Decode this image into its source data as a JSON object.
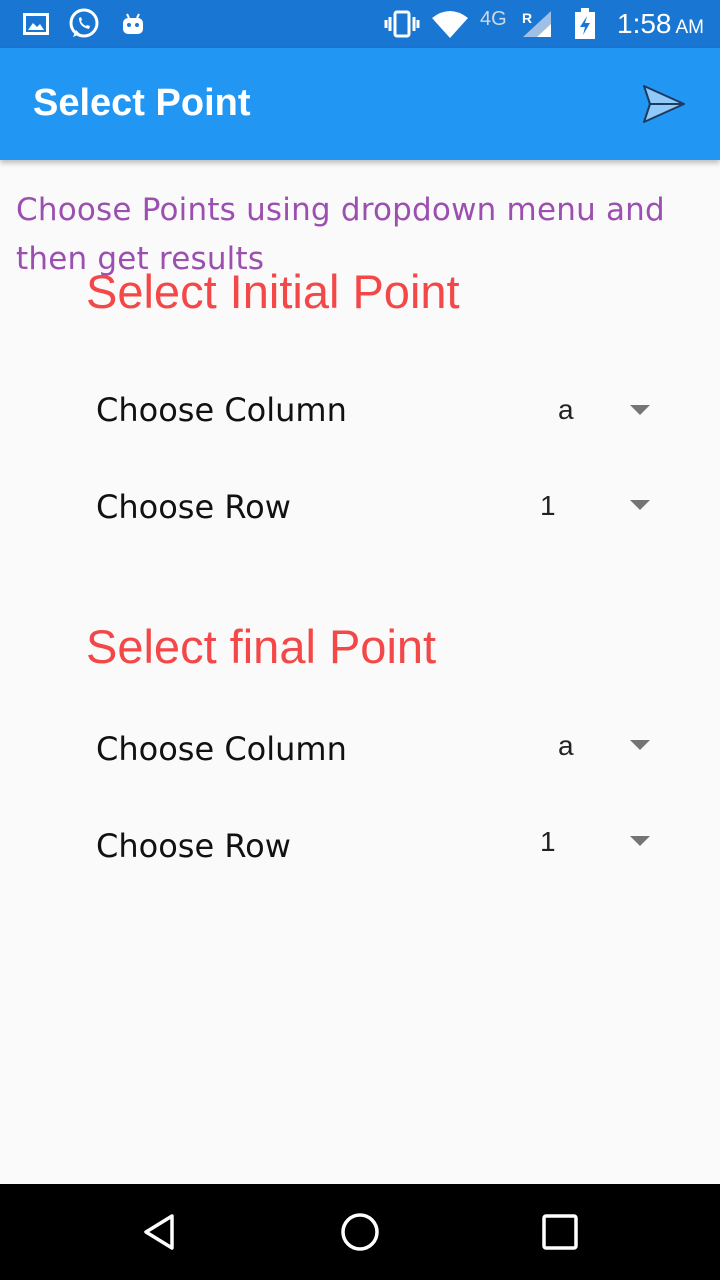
{
  "status_bar": {
    "time": "1:58",
    "ampm": "AM",
    "network_label": "4G",
    "roaming_label": "R",
    "icons": [
      "gallery-icon",
      "whatsapp-icon",
      "android-icon",
      "vibrate-icon",
      "wifi-icon",
      "signal-icon",
      "battery-charging-icon"
    ]
  },
  "app_bar": {
    "title": "Select Point",
    "action_icon": "send-icon",
    "color": "#2196f3",
    "status_color": "#1976d2"
  },
  "instruction": "Choose Points using dropdown menu and then get results",
  "sections": [
    {
      "title": "Select Initial Point",
      "column_label": "Choose Column",
      "column_value": "a",
      "row_label": "Choose Row",
      "row_value": "1"
    },
    {
      "title": "Select final Point",
      "column_label": "Choose Column",
      "column_value": "a",
      "row_label": "Choose Row",
      "row_value": "1"
    }
  ],
  "nav_bar": {
    "icons": [
      "back-icon",
      "home-icon",
      "recents-icon"
    ]
  },
  "colors": {
    "instruction": "#9c4fb0",
    "section_title": "#f44848"
  }
}
